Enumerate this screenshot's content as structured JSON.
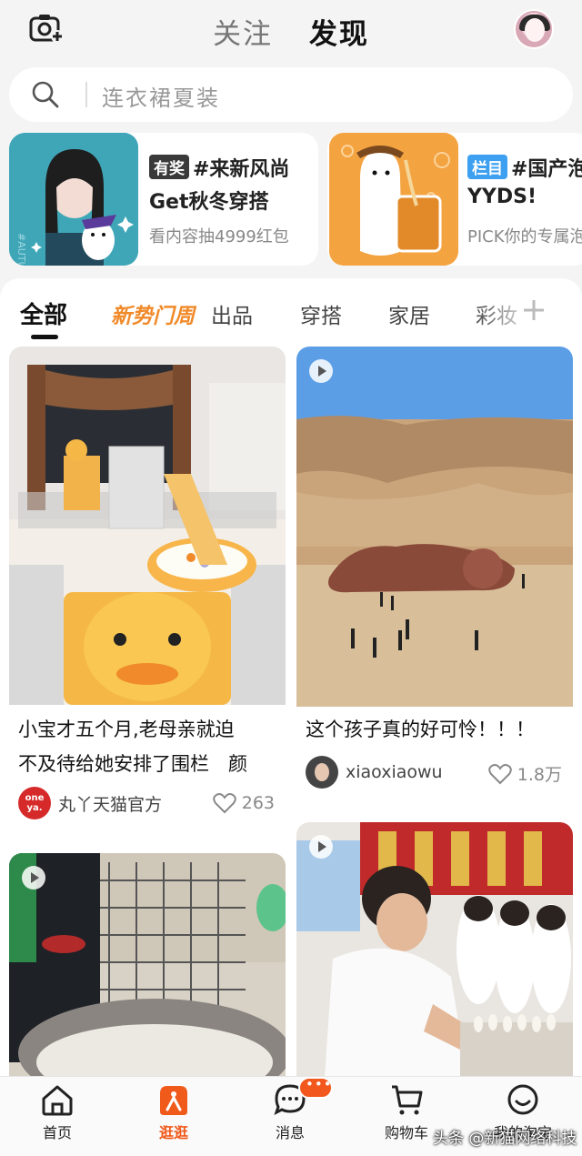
{
  "header": {
    "tabs": [
      "关注",
      "发现"
    ],
    "active_tab": "发现",
    "camera_icon": "camera-plus-icon",
    "avatar_icon": "user-avatar"
  },
  "search": {
    "placeholder": "连衣裙夏装",
    "icon": "search-icon"
  },
  "banners": [
    {
      "tag": "有奖",
      "title": "#来新风尚",
      "subtitle": "Get秋冬穿搭",
      "desc": "看内容抽4999红包"
    },
    {
      "tag": "栏目",
      "title": "#国产泡",
      "subtitle": "YYDS!",
      "desc": "PICK你的专属泡"
    }
  ],
  "categories": [
    "全部",
    "新势门周",
    "出品",
    "穿搭",
    "家居",
    "彩妆"
  ],
  "active_category": "全部",
  "cards": [
    {
      "title_lines": [
        "小宝才五个月,老母亲就迫",
        "不及待给她安排了围栏　颜"
      ],
      "author": "丸丫天猫官方",
      "author_badge": "one ya.",
      "likes": "263",
      "video": false
    },
    {
      "title_lines": [
        "这个孩子真的好可怜！！！"
      ],
      "author": "xiaoxiaowu",
      "likes": "1.8万",
      "video": true
    },
    {
      "title_lines": [],
      "author": "",
      "likes": "",
      "video": true
    },
    {
      "title_lines": [],
      "author": "",
      "likes": "",
      "video": true
    }
  ],
  "bottom_nav": [
    {
      "label": "首页",
      "icon": "home-icon",
      "active": false
    },
    {
      "label": "逛逛",
      "icon": "browse-icon",
      "active": true
    },
    {
      "label": "消息",
      "icon": "message-icon",
      "active": false
    },
    {
      "label": "购物车",
      "icon": "cart-icon",
      "active": false
    },
    {
      "label": "我的淘宝",
      "icon": "profile-icon",
      "active": false
    }
  ],
  "watermark": "头条 @新猫网络科技",
  "colors": {
    "accent": "#f05a1a",
    "hot": "#f08a2a",
    "background": "#f4f4f4"
  }
}
